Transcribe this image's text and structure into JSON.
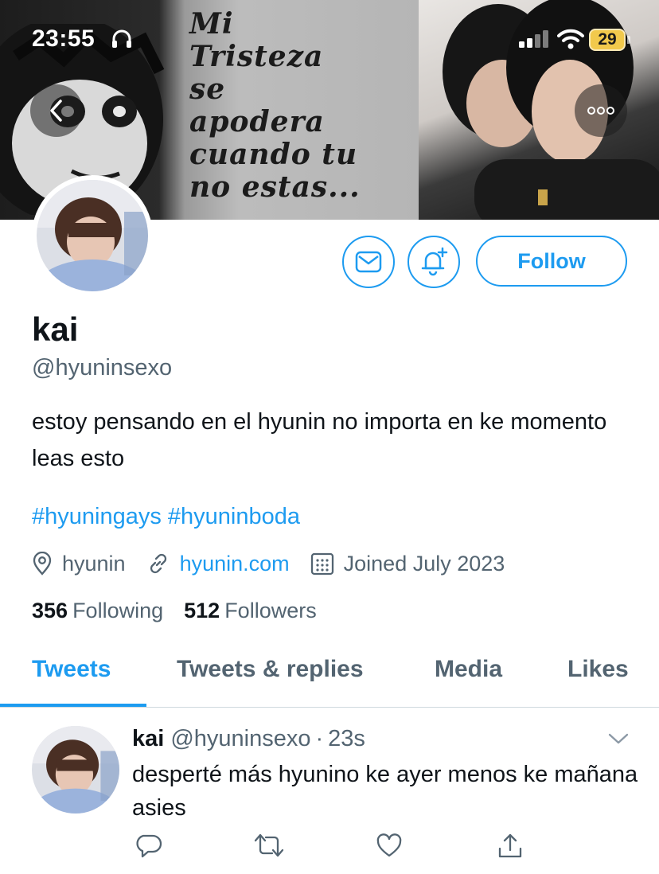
{
  "status_bar": {
    "time": "23:55",
    "battery": "29",
    "battery_color": "#f2c94c"
  },
  "banner": {
    "quote_lines": [
      "Mi",
      "Tristeza",
      "se",
      "apodera",
      "cuando tu",
      "no estas..."
    ]
  },
  "nav": {
    "back_icon": "chevron-left-icon",
    "more_icon": "more-horizontal-icon"
  },
  "profile": {
    "follow_label": "Follow",
    "display_name": "kai",
    "handle": "@hyuninsexo",
    "bio": "estoy pensando en el hyunin no importa en ke momento leas esto",
    "hashtags": [
      "#hyuningays",
      "#hyuninboda"
    ],
    "location": "hyunin",
    "website": "hyunin.com",
    "joined": "Joined July 2023",
    "following_count": "356",
    "following_label": "Following",
    "followers_count": "512",
    "followers_label": "Followers"
  },
  "tabs": [
    {
      "label": "Tweets",
      "active": true
    },
    {
      "label": "Tweets & replies",
      "active": false
    },
    {
      "label": "Media",
      "active": false
    },
    {
      "label": "Likes",
      "active": false
    }
  ],
  "tweet": {
    "name": "kai",
    "handle": "@hyuninsexo",
    "separator": "·",
    "time": "23s",
    "text": "desperté más hyunino ke ayer menos ke mañana asies"
  },
  "colors": {
    "accent": "#1d9bf0",
    "secondary_text": "#536471",
    "primary_text": "#0f1419"
  }
}
